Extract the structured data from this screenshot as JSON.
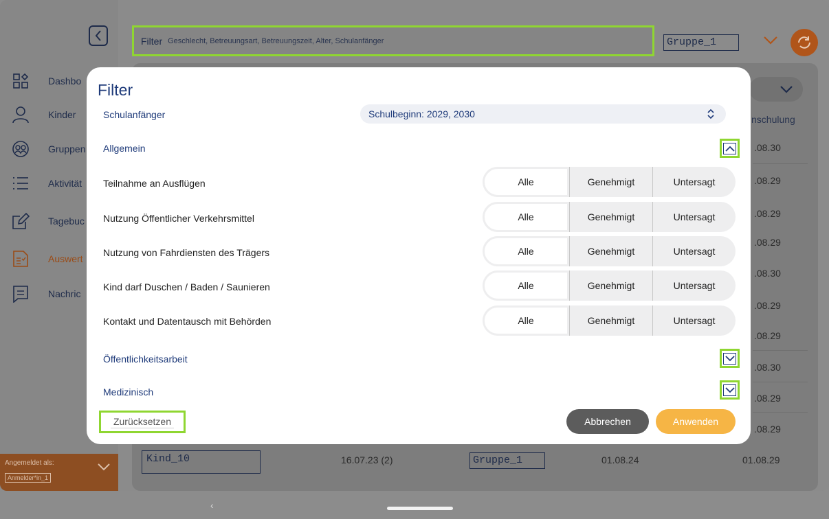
{
  "sidebar": {
    "items": [
      {
        "label": "Dashbo",
        "icon": "dashboard-icon"
      },
      {
        "label": "Kinder",
        "icon": "person-icon"
      },
      {
        "label": "Gruppen",
        "icon": "group-icon"
      },
      {
        "label": "Aktivität",
        "icon": "list-icon"
      },
      {
        "label": "Tagebuc",
        "icon": "edit-icon"
      },
      {
        "label": "Auswert",
        "icon": "report-icon"
      },
      {
        "label": "Nachric",
        "icon": "message-icon"
      }
    ],
    "login_label": "Angemeldet als:",
    "login_user": "Anmelder*in_1"
  },
  "topbar": {
    "filter_title": "Filter",
    "filter_summary": "Geschlecht, Betreuungsart, Betreuungszeit, Alter, Schulanfänger",
    "group_value": "Gruppe_1"
  },
  "background_table": {
    "right_header": "nschulung",
    "right_values": [
      ".08.30",
      ".08.29",
      ".08.29",
      ".08.29",
      ".08.30",
      ".08.29",
      ".08.29",
      ".08.30",
      ".08.29",
      ".08.29"
    ],
    "last_row": {
      "name": "Kind_10",
      "birth": "16.07.23 (2)",
      "group": "Gruppe_1",
      "aufnahme": "01.08.24",
      "einschulung": "01.08.29"
    }
  },
  "modal": {
    "title": "Filter",
    "schulanfaenger_label": "Schulanfänger",
    "schulanfaenger_value": "Schulbeginn: 2029, 2030",
    "allgemein_label": "Allgemein",
    "rows": [
      {
        "label": "Teilnahme an Ausflügen",
        "options": [
          "Alle",
          "Genehmigt",
          "Untersagt"
        ],
        "selected": "Alle"
      },
      {
        "label": "Nutzung Öffentlicher Verkehrsmittel",
        "options": [
          "Alle",
          "Genehmigt",
          "Untersagt"
        ],
        "selected": "Alle"
      },
      {
        "label": "Nutzung von Fahrdiensten des Trägers",
        "options": [
          "Alle",
          "Genehmigt",
          "Untersagt"
        ],
        "selected": "Alle"
      },
      {
        "label": "Kind darf Duschen / Baden / Saunieren",
        "options": [
          "Alle",
          "Genehmigt",
          "Untersagt"
        ],
        "selected": "Alle"
      },
      {
        "label": "Kontakt und Datentausch mit Behörden",
        "options": [
          "Alle",
          "Genehmigt",
          "Untersagt"
        ],
        "selected": "Alle"
      }
    ],
    "oeffentlichkeit_label": "Öffentlichkeitsarbeit",
    "medizinisch_label": "Medizinisch",
    "reset_label": "Zurücksetzen",
    "cancel_label": "Abbrechen",
    "apply_label": "Anwenden"
  },
  "colors": {
    "highlight": "#8fd631",
    "primary_text": "#1f3b7a",
    "apply": "#f6b545",
    "cancel": "#5c5c5c",
    "accent": "#b0551a"
  }
}
